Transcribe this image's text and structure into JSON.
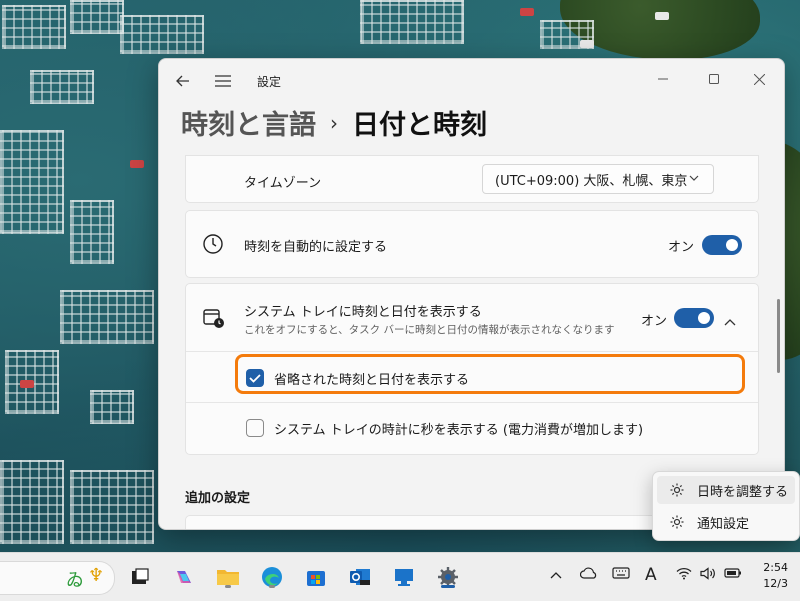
{
  "window": {
    "app_title": "設定",
    "breadcrumb_parent": "時刻と言語",
    "breadcrumb_separator": "›",
    "breadcrumb_current": "日付と時刻"
  },
  "timezone": {
    "label": "タイムゾーン",
    "value": "(UTC+09:00) 大阪、札幌、東京"
  },
  "auto_time": {
    "label": "時刻を自動的に設定する",
    "state_text": "オン"
  },
  "tray_display": {
    "label": "システム トレイに時刻と日付を表示する",
    "description": "これをオフにすると、タスク バーに時刻と日付の情報が表示されなくなります",
    "state_text": "オン",
    "options": [
      {
        "label": "省略された時刻と日付を表示する",
        "checked": true
      },
      {
        "label": "システム トレイの時計に秒を表示する (電力消費が増加します)",
        "checked": false
      }
    ]
  },
  "additional": {
    "section_title": "追加の設定"
  },
  "context_menu": {
    "items": [
      {
        "label": "日時を調整する",
        "icon": "gear-icon"
      },
      {
        "label": "通知設定",
        "icon": "gear-icon"
      }
    ]
  },
  "taskbar": {
    "clock_time": "2:54",
    "clock_date": "12/3",
    "ime_indicator": "A"
  },
  "colors": {
    "accent": "#1f5fa8",
    "highlight": "#f47b0c"
  }
}
